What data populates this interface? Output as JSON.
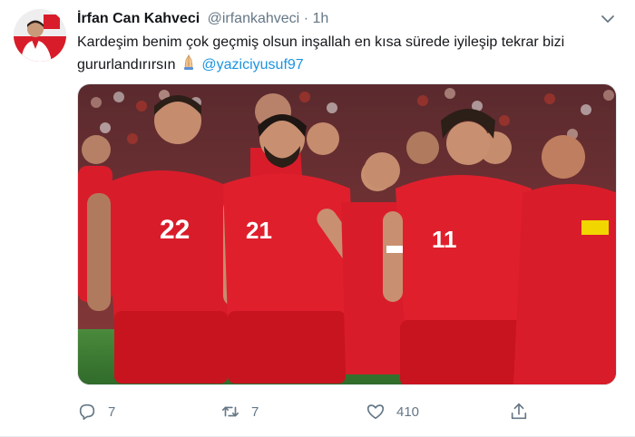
{
  "tweet": {
    "author_name": "İrfan Can Kahveci",
    "handle": "@irfankahveci",
    "separator": "·",
    "time": "1h",
    "text": "Kardeşim benim çok geçmiş olsun inşallah en kısa sürede iyileşip tekrar bizi gururlandırırsın",
    "emoji": "folded-hands",
    "mention": "@yaziciyusuf97"
  },
  "media": {
    "description_icon": "team-photo",
    "jersey_numbers": [
      "22",
      "21",
      "11"
    ]
  },
  "actions": {
    "reply_count": "7",
    "retweet_count": "7",
    "like_count": "410",
    "share_icon": "share-icon"
  },
  "colors": {
    "accent": "#1b95e0",
    "muted": "#657786",
    "jersey_red": "#d91c2a",
    "pitch_green": "#3d7a35"
  }
}
